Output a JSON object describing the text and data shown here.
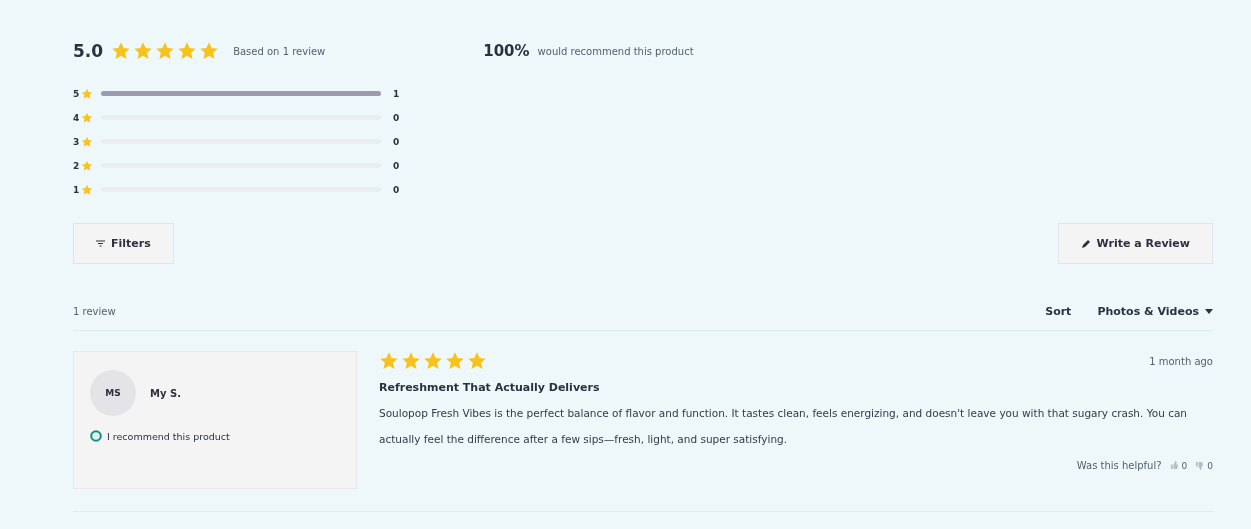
{
  "summary": {
    "average": "5.0",
    "stars": 5,
    "based_on": "Based on 1 review",
    "recommend_percent": "100%",
    "recommend_text": "would recommend this product"
  },
  "histogram": [
    {
      "label": "5",
      "level": 1,
      "count": "1"
    },
    {
      "label": "4",
      "level": 0,
      "count": "0"
    },
    {
      "label": "3",
      "level": 0,
      "count": "0"
    },
    {
      "label": "2",
      "level": 0,
      "count": "0"
    },
    {
      "label": "1",
      "level": 0,
      "count": "0"
    }
  ],
  "filters_button": "Filters",
  "write_button": "Write a Review",
  "review_count": "1 review",
  "sort_label": "Sort",
  "sort_value": "Photos & Videos",
  "reviews": [
    {
      "initials": "MS",
      "name": "My S.",
      "recommend": "I recommend this product",
      "stars": 5,
      "date": "1 month ago",
      "title": "Refreshment That Actually Delivers",
      "body": "Soulopop Fresh Vibes is the perfect balance of flavor and function. It tastes clean, feels energizing, and doesn't leave you with that sugary crash. You can actually feel the difference after a few sips—fresh, light, and super satisfying.",
      "helpful": "Was this helpful?",
      "up": "0",
      "down": "0"
    }
  ]
}
